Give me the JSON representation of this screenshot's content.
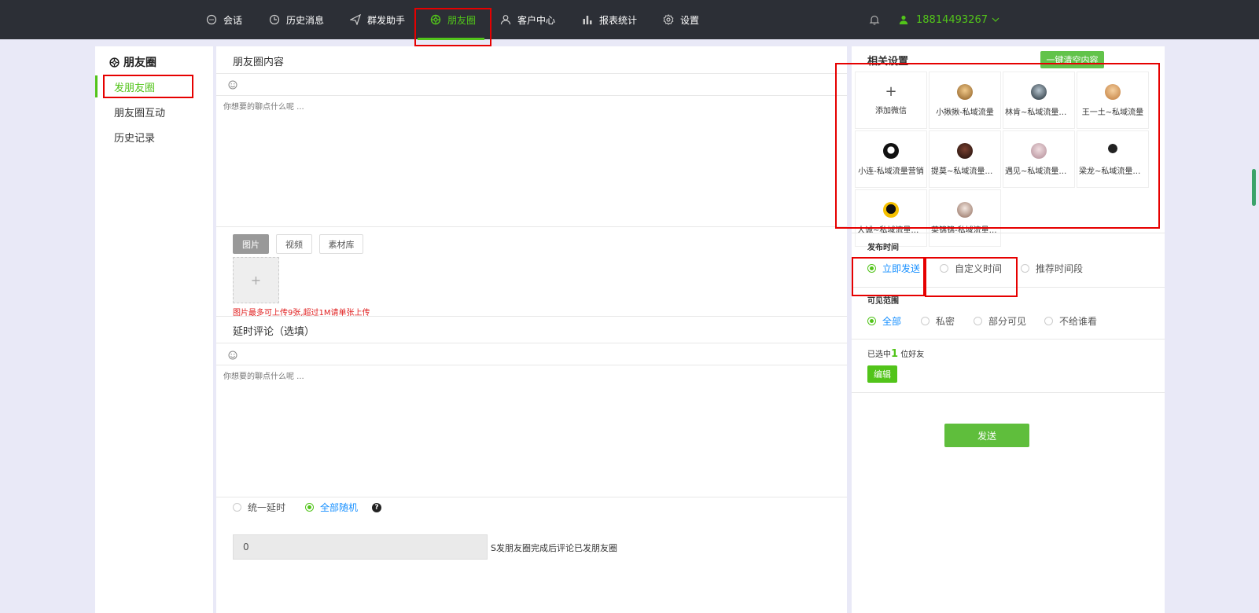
{
  "nav": {
    "items": [
      {
        "label": "会话",
        "icon": "chat-icon"
      },
      {
        "label": "历史消息",
        "icon": "clock-icon"
      },
      {
        "label": "群发助手",
        "icon": "send-icon"
      },
      {
        "label": "朋友圈",
        "icon": "moments-icon",
        "active": true
      },
      {
        "label": "客户中心",
        "icon": "user-icon"
      },
      {
        "label": "报表统计",
        "icon": "bar-chart-icon"
      },
      {
        "label": "设置",
        "icon": "gear-icon"
      }
    ],
    "user_phone": "18814493267",
    "accent_color": "#52c41a"
  },
  "sidebar": {
    "title": "朋友圈",
    "items": [
      {
        "label": "发朋友圈",
        "active": true
      },
      {
        "label": "朋友圈互动"
      },
      {
        "label": "历史记录"
      }
    ]
  },
  "content": {
    "title": "朋友圈内容",
    "placeholder": "你想要的聊点什么呢 ...",
    "media_tabs": [
      "图片",
      "视频",
      "素材库"
    ],
    "upload_plus": "+",
    "upload_hint": "图片最多可上传9张,超过1M请单张上传",
    "delay_title": "延时评论（选填）",
    "delay_placeholder": "你想要的聊点什么呢 ...",
    "delay_options": [
      "统一延时",
      "全部随机"
    ],
    "delay_value": "0",
    "delay_suffix": "S发朋友圈完成后评论已发朋友圈",
    "help_glyph": "?"
  },
  "settings": {
    "title": "相关设置",
    "clear_button": "一键清空内容",
    "add_wechat": "添加微信",
    "add_plus": "+",
    "accounts": [
      "小揪揪-私域流量",
      "林肯~私域流量营销",
      "王一土~私域流量",
      "小连-私域流量营销",
      "提莫~私域流量营销",
      "遇见~私域流量营销",
      "梁龙~私域流量营销",
      "大诚~私域流量营销",
      "菜锦锦-私域流量营销"
    ],
    "publish_time_label": "发布时间",
    "publish_options": [
      "立即发送",
      "自定义时间",
      "推荐时间段"
    ],
    "visibility_label": "可见范围",
    "visibility_options": [
      "全部",
      "私密",
      "部分可见",
      "不给谁看"
    ],
    "selected_prefix": "已选中",
    "selected_count": "1",
    "selected_suffix": "位好友",
    "edit_button": "编辑",
    "send_button": "发送"
  }
}
